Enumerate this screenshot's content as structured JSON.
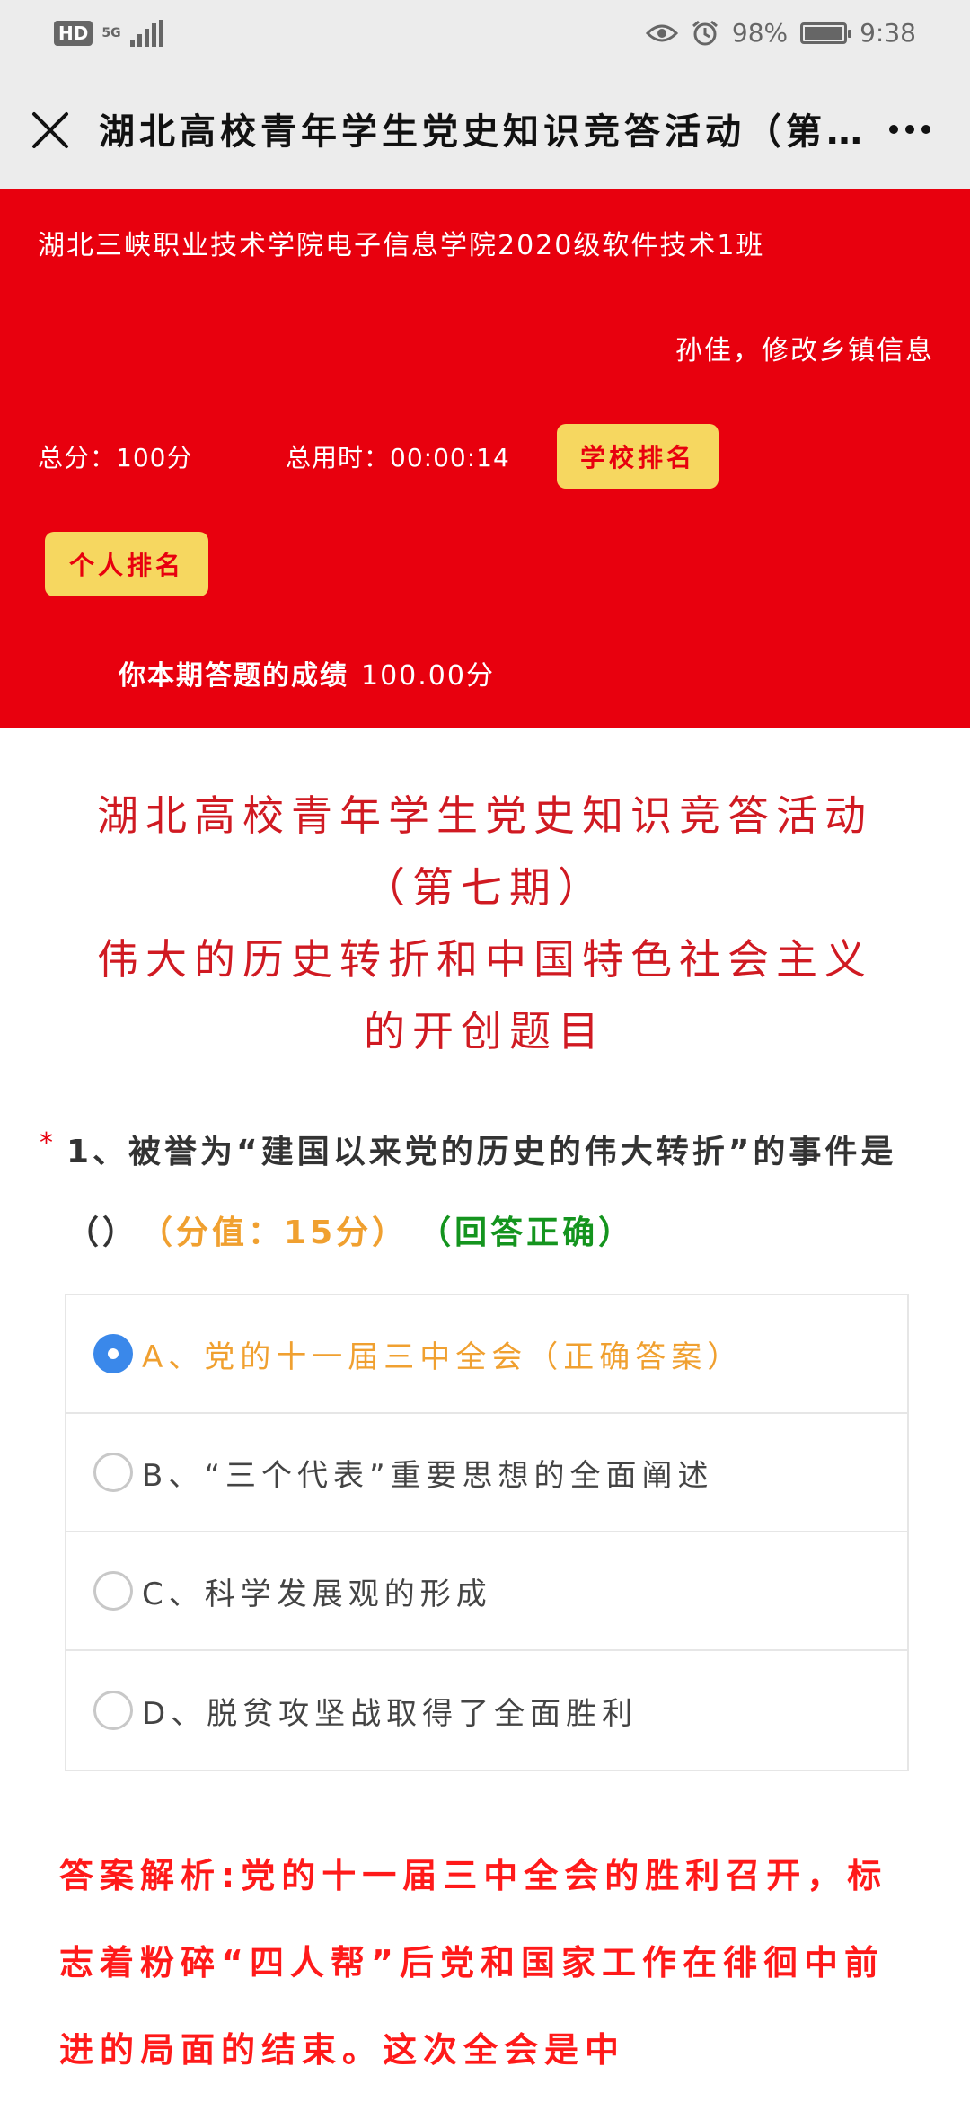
{
  "status_bar": {
    "hd": "HD",
    "network": "5G",
    "battery_percent": "98%",
    "battery_level": 0.98,
    "time": "9:38",
    "icons": [
      "eye-icon",
      "alarm-icon",
      "battery-icon",
      "signal-icon"
    ]
  },
  "title_bar": {
    "title": "湖北高校青年学生党史知识竞答活动（第…",
    "close_icon": "close-icon",
    "more_icon": "more-icon"
  },
  "header": {
    "school": "湖北三峡职业技术学院电子信息学院2020级软件技术1班",
    "edit_link": "孙佳，修改乡镇信息",
    "total_score": "总分：100分",
    "total_time": "总用时：00:00:14",
    "school_rank": "学校排名",
    "personal_rank": "个人排名",
    "result_label": "你本期答题的成绩",
    "result_score": "100.00分"
  },
  "quiz": {
    "title_line1": "湖北高校青年学生党史知识竞答活动",
    "title_line2": "（第七期）",
    "title_line3": "伟大的历史转折和中国特色社会主义",
    "title_line4": "的开创题目",
    "question_star": "*",
    "question_text": "1、被誉为“建国以来党的历史的伟大转折”的事件是（）",
    "points": "（分值：15分）",
    "correct_label": "（回答正确）",
    "options": [
      {
        "label": "A、党的十一届三中全会（正确答案）",
        "selected": true
      },
      {
        "label": "B、“三个代表”重要思想的全面阐述",
        "selected": false
      },
      {
        "label": "C、科学发展观的形成",
        "selected": false
      },
      {
        "label": "D、脱贫攻坚战取得了全面胜利",
        "selected": false
      }
    ],
    "analysis": "答案解析:党的十一届三中全会的胜利召开，标志着粉碎“四人帮”后党和国家工作在徘徊中前进的局面的结束。这次全会是中"
  },
  "colors": {
    "header_red": "#e8000e",
    "button_yellow": "#f6d760",
    "title_red": "#d01a22",
    "points_orange": "#f0a030",
    "correct_green": "#14941e",
    "radio_blue": "#3a88ea",
    "analysis_red": "#ff1a1a"
  }
}
